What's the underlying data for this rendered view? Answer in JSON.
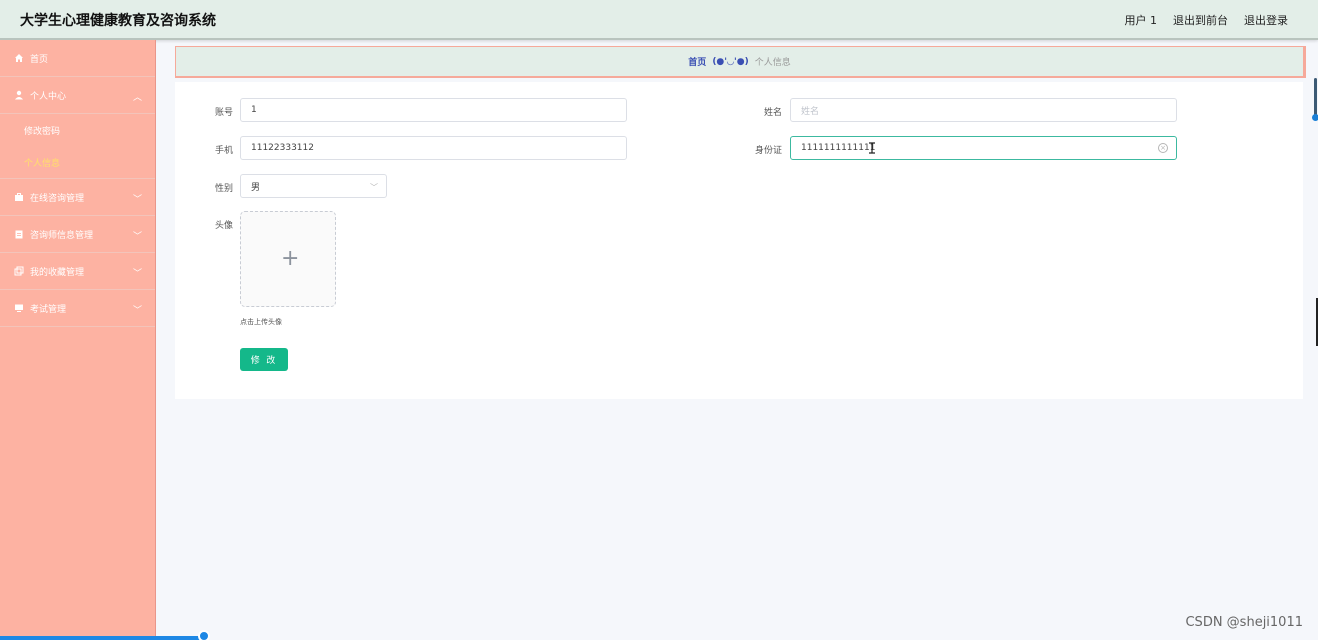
{
  "header": {
    "title": "大学生心理健康教育及咨询系统",
    "user_label": "用户 1",
    "front_label": "退出到前台",
    "logout_label": "退出登录"
  },
  "sidebar": {
    "items": [
      {
        "label": "首页",
        "icon": "home-icon"
      },
      {
        "label": "个人中心",
        "icon": "user-icon",
        "expanded": true,
        "children": [
          {
            "label": "修改密码"
          },
          {
            "label": "个人信息",
            "active": true
          }
        ]
      },
      {
        "label": "在线咨询管理",
        "icon": "briefcase-icon"
      },
      {
        "label": "咨询师信息管理",
        "icon": "clipboard-icon"
      },
      {
        "label": "我的收藏管理",
        "icon": "copy-icon"
      },
      {
        "label": "考试管理",
        "icon": "monitor-icon"
      }
    ]
  },
  "breadcrumb": {
    "home": "首页",
    "face": "(●'◡'●)",
    "current": "个人信息"
  },
  "form": {
    "account_label": "账号",
    "account_value": "1",
    "name_label": "姓名",
    "name_placeholder": "姓名",
    "phone_label": "手机",
    "phone_value": "11122333112",
    "idcard_label": "身份证",
    "idcard_value": "1111111111111",
    "gender_label": "性别",
    "gender_value": "男",
    "avatar_label": "头像",
    "upload_tip": "点击上传头像",
    "submit_label": "修 改"
  },
  "watermark": "CSDN @sheji1011",
  "colors": {
    "sidebar_bg": "#fdb2a2",
    "header_bg": "#e3eee8",
    "primary_button": "#14b88a",
    "active_submenu": "#ffe06a"
  }
}
